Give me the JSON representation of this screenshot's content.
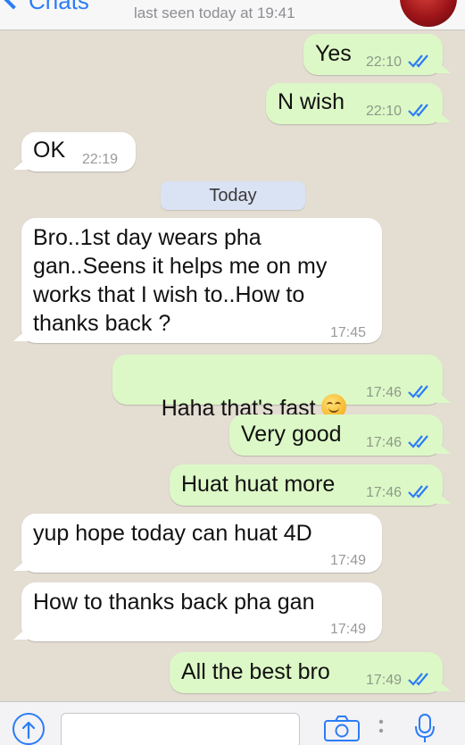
{
  "header": {
    "back_label": "Chats",
    "status": "last seen today at 19:41"
  },
  "day_separator": "Today",
  "messages": [
    {
      "direction": "out",
      "text": "Yes",
      "time": "22:10",
      "read": true
    },
    {
      "direction": "out",
      "text": "N wish",
      "time": "22:10",
      "read": true
    },
    {
      "direction": "in",
      "text": "OK",
      "time": "22:19"
    },
    {
      "direction": "in",
      "text": "Bro..1st day wears pha\ngan..Seens it helps me on my\nworks that I wish to..How to\nthanks back ?",
      "time": "17:45"
    },
    {
      "direction": "out",
      "text": "Haha that's fast",
      "emoji": "smiling-face",
      "time": "17:46",
      "read": true
    },
    {
      "direction": "out",
      "text": "Very good",
      "time": "17:46",
      "read": true
    },
    {
      "direction": "out",
      "text": "Huat huat more",
      "time": "17:46",
      "read": true
    },
    {
      "direction": "in",
      "text": "yup hope today can huat 4D",
      "time": "17:49"
    },
    {
      "direction": "in",
      "text": "How to thanks back pha gan",
      "time": "17:49"
    },
    {
      "direction": "out",
      "text": "All the best bro",
      "time": "17:49",
      "read": true
    }
  ],
  "input": {
    "placeholder": "",
    "value": ""
  },
  "icons": {
    "upload": "upload-arrow-icon",
    "camera": "camera-icon",
    "mic": "microphone-icon"
  },
  "colors": {
    "accent": "#2c7cf6",
    "outgoing_bubble": "#dcf8c6",
    "incoming_bubble": "#ffffff",
    "background": "#e3ddd2",
    "read_ticks": "#2c7cf6"
  }
}
